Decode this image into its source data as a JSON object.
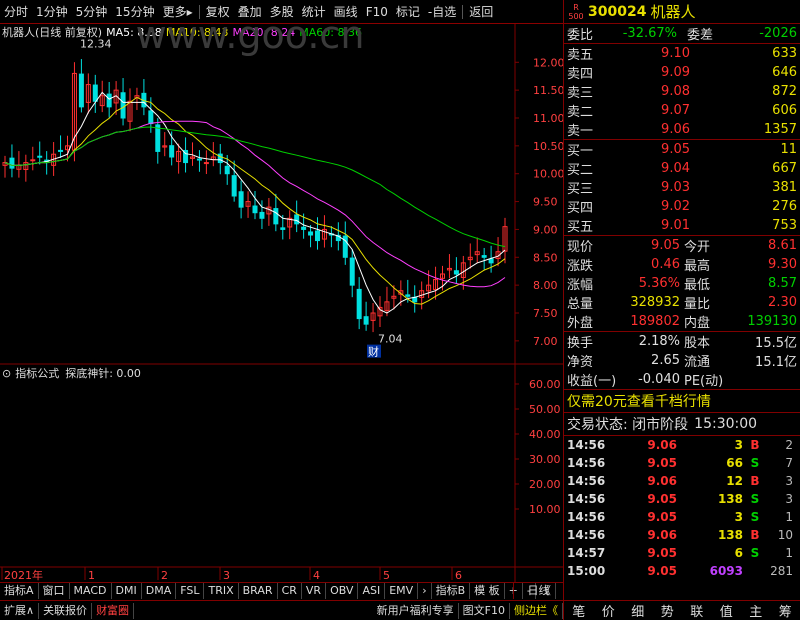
{
  "toolbar": {
    "items": [
      "分时",
      "1分钟",
      "5分钟",
      "15分钟",
      "更多▸",
      "复权",
      "叠加",
      "多股",
      "统计",
      "画线",
      "F10",
      "标记",
      "-自选",
      "返回"
    ]
  },
  "chart_info": {
    "stock": "机器人(日线 前复权)",
    "ma5": "MA5: 8.58",
    "ma10": "MA10: 8.43",
    "ma20": "MA20: 8.24",
    "ma60": "MA60: 8.36",
    "watermark": "www.goo.cn"
  },
  "colors": {
    "ma5": "#ffffff",
    "ma10": "#e8e000",
    "ma20": "#ff40ff",
    "ma60": "#00d000",
    "up": "#ff3030",
    "down": "#00e0e0"
  },
  "chart_data": {
    "type": "line",
    "ylim": [
      6.8,
      12.4
    ],
    "yticks": [
      "12.00",
      "11.50",
      "11.00",
      "10.50",
      "10.00",
      "9.50",
      "9.00",
      "8.50",
      "8.00",
      "7.50",
      "7.00"
    ],
    "high_label": "12.34",
    "low_label": "7.04",
    "fin_marker": "财",
    "x_labels": [
      "2021年",
      "1",
      "2",
      "3",
      "4",
      "5",
      "6"
    ],
    "close": [
      10.2,
      10.1,
      10.15,
      10.2,
      10.25,
      10.3,
      10.2,
      10.35,
      10.4,
      10.5,
      11.8,
      11.2,
      11.6,
      11.3,
      11.4,
      11.2,
      11.5,
      11.0,
      11.3,
      11.4,
      11.2,
      10.9,
      10.4,
      10.5,
      10.3,
      10.4,
      10.2,
      10.3,
      10.25,
      10.2,
      10.3,
      10.2,
      10.0,
      9.6,
      9.4,
      9.5,
      9.3,
      9.2,
      9.4,
      9.1,
      9.0,
      9.2,
      9.1,
      9.0,
      8.9,
      8.8,
      9.0,
      8.9,
      8.8,
      8.5,
      8.0,
      7.4,
      7.3,
      7.5,
      7.6,
      7.7,
      7.8,
      7.9,
      7.8,
      7.7,
      7.9,
      8.0,
      8.1,
      8.2,
      8.3,
      8.2,
      8.4,
      8.5,
      8.6,
      8.5,
      8.4,
      8.6,
      9.05
    ]
  },
  "indicator": {
    "title": "指标公式",
    "name": "探底神针: 0.00",
    "yticks": [
      "60.00",
      "50.00",
      "40.00",
      "30.00",
      "20.00",
      "10.00"
    ]
  },
  "tabs": [
    "指标A",
    "窗口",
    "MACD",
    "DMI",
    "DMA",
    "FSL",
    "TRIX",
    "BRAR",
    "CR",
    "VR",
    "OBV",
    "ASI",
    "EMV",
    "›",
    "指标B",
    "模 板",
    "+",
    "-",
    "《"
  ],
  "period_label": "日线",
  "bottom": {
    "left": [
      "扩展∧",
      "关联报价",
      "财富圈"
    ],
    "right": [
      "新用户福利专享",
      "图文F10",
      "侧边栏《"
    ],
    "buttons": [
      "笔",
      "价",
      "细",
      "势",
      "联",
      "值",
      "主",
      "筹"
    ]
  },
  "quote": {
    "code": "300024",
    "name": "机器人",
    "badge_top": "R",
    "badge_bottom": "500",
    "ratio_label": "委比",
    "ratio": "-32.67%",
    "diff_label": "委差",
    "diff": "-2026",
    "asks": [
      {
        "label": "卖五",
        "price": "9.10",
        "vol": "633"
      },
      {
        "label": "卖四",
        "price": "9.09",
        "vol": "646"
      },
      {
        "label": "卖三",
        "price": "9.08",
        "vol": "872"
      },
      {
        "label": "卖二",
        "price": "9.07",
        "vol": "606"
      },
      {
        "label": "卖一",
        "price": "9.06",
        "vol": "1357"
      }
    ],
    "bids": [
      {
        "label": "买一",
        "price": "9.05",
        "vol": "11"
      },
      {
        "label": "买二",
        "price": "9.04",
        "vol": "667"
      },
      {
        "label": "买三",
        "price": "9.03",
        "vol": "381"
      },
      {
        "label": "买四",
        "price": "9.02",
        "vol": "276"
      },
      {
        "label": "买五",
        "price": "9.01",
        "vol": "753"
      }
    ],
    "stats": [
      {
        "l1": "现价",
        "v1": "9.05",
        "c1": "red",
        "l2": "今开",
        "v2": "8.61",
        "c2": "red"
      },
      {
        "l1": "涨跌",
        "v1": "0.46",
        "c1": "red",
        "l2": "最高",
        "v2": "9.30",
        "c2": "red"
      },
      {
        "l1": "涨幅",
        "v1": "5.36%",
        "c1": "red",
        "l2": "最低",
        "v2": "8.57",
        "c2": "green"
      },
      {
        "l1": "总量",
        "v1": "328932",
        "c1": "yellow",
        "l2": "量比",
        "v2": "2.30",
        "c2": "red"
      },
      {
        "l1": "外盘",
        "v1": "189802",
        "c1": "red",
        "l2": "内盘",
        "v2": "139130",
        "c2": "green"
      }
    ],
    "stats2": [
      {
        "l1": "换手",
        "v1": "2.18%",
        "l2": "股本",
        "v2": "15.5亿"
      },
      {
        "l1": "净资",
        "v1": "2.65",
        "l2": "流通",
        "v2": "15.1亿"
      },
      {
        "l1": "收益(一)",
        "v1": "-0.040",
        "l2": "PE(动)",
        "v2": ""
      }
    ],
    "promo": "仅需20元查看千档行情",
    "status_label": "交易状态: 闭市阶段",
    "status_time": "15:30:00",
    "trades": [
      {
        "t": "14:56",
        "p": "9.06",
        "v": "3",
        "s": "B",
        "n": "2"
      },
      {
        "t": "14:56",
        "p": "9.05",
        "v": "66",
        "s": "S",
        "n": "7"
      },
      {
        "t": "14:56",
        "p": "9.06",
        "v": "12",
        "s": "B",
        "n": "3"
      },
      {
        "t": "14:56",
        "p": "9.05",
        "v": "138",
        "s": "S",
        "n": "3"
      },
      {
        "t": "14:56",
        "p": "9.05",
        "v": "3",
        "s": "S",
        "n": "1"
      },
      {
        "t": "14:56",
        "p": "9.06",
        "v": "138",
        "s": "B",
        "n": "10"
      },
      {
        "t": "14:57",
        "p": "9.05",
        "v": "6",
        "s": "S",
        "n": "1"
      },
      {
        "t": "15:00",
        "p": "9.05",
        "v": "6093",
        "s": "",
        "n": "281"
      }
    ]
  }
}
